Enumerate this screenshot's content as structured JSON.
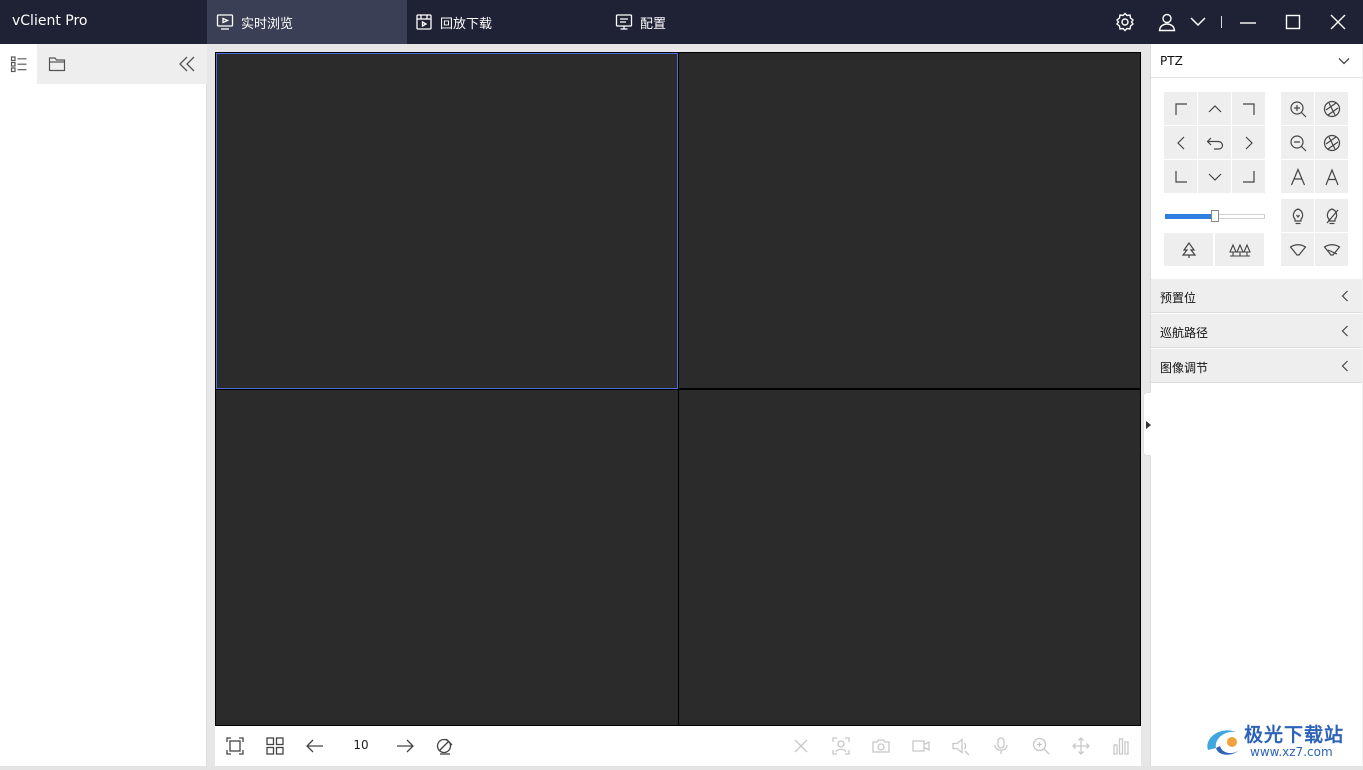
{
  "app": {
    "title": "vClient Pro"
  },
  "nav": {
    "tabs": [
      {
        "label": "实时浏览",
        "icon": "live-view-icon",
        "active": true
      },
      {
        "label": "回放下载",
        "icon": "playback-icon",
        "active": false
      },
      {
        "label": "配置",
        "icon": "config-icon",
        "active": false
      }
    ]
  },
  "window_controls": [
    "settings-icon",
    "user-icon",
    "chevron-down-icon",
    "minimize-icon",
    "maximize-icon",
    "close-icon"
  ],
  "left_panel": {
    "tabs": [
      "device-list-icon",
      "folder-icon"
    ],
    "collapse_icon": "double-chevron-left-icon"
  },
  "video_grid": {
    "layout": "2x2",
    "selected_cell": 1
  },
  "bottom_toolbar": {
    "page_number": "10",
    "left_icons": [
      "fullscreen-icon",
      "grid-layout-icon",
      "prev-page-icon",
      "next-page-icon",
      "patrol-icon"
    ],
    "right_icons": [
      "close-all-icon",
      "face-capture-icon",
      "snapshot-icon",
      "record-icon",
      "audio-icon",
      "talk-icon",
      "digital-zoom-icon",
      "ptz-move-icon",
      "stats-icon"
    ]
  },
  "ptz": {
    "title": "PTZ",
    "speed_level": 0.5,
    "direction_buttons": [
      "up-left",
      "up",
      "up-right",
      "left",
      "return",
      "right",
      "down-left",
      "down",
      "down-right"
    ],
    "lens_buttons": [
      "zoom-in",
      "focus-near",
      "zoom-out",
      "focus-far",
      "iris-open",
      "iris-close"
    ],
    "aux_buttons": [
      "light-on",
      "light-off",
      "wiper-on",
      "wiper-off"
    ]
  },
  "sections": [
    {
      "label": "预置位"
    },
    {
      "label": "巡航路径"
    },
    {
      "label": "图像调节"
    }
  ],
  "watermark": {
    "text": "极光下载站",
    "url": "www.xz7.com"
  },
  "colors": {
    "titlebar": "#1f2235",
    "active_tab": "#3b3f55",
    "video_bg": "#2b2b2b",
    "selected_border": "#4e6fd2",
    "slider_fill": "#2f7fe0"
  }
}
